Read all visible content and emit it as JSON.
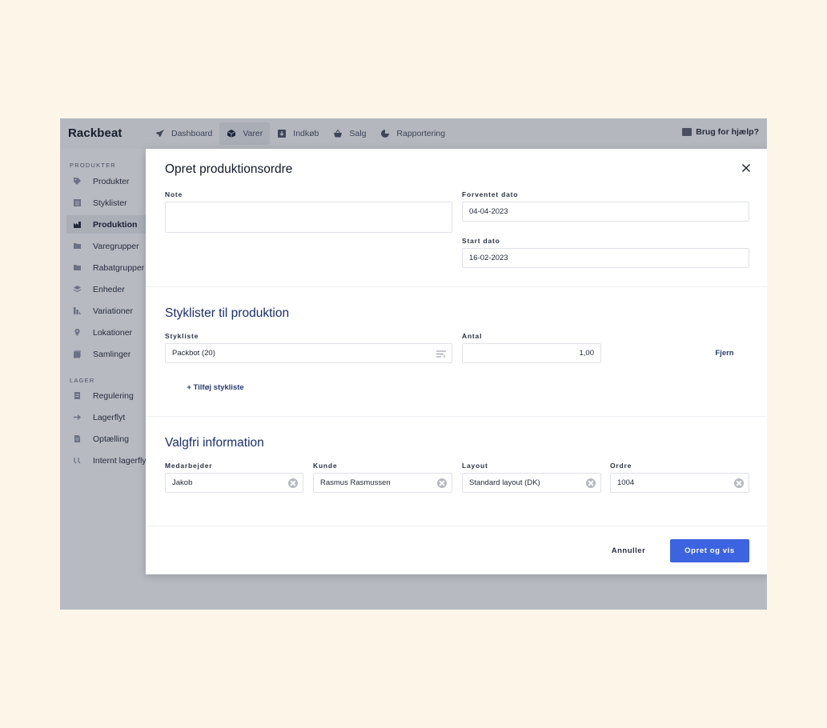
{
  "app": {
    "logo": "Rackbeat",
    "nav": [
      {
        "label": "Dashboard",
        "icon": "rocket-icon"
      },
      {
        "label": "Varer",
        "icon": "box-icon",
        "active": true
      },
      {
        "label": "Indkøb",
        "icon": "download-icon"
      },
      {
        "label": "Salg",
        "icon": "basket-icon"
      },
      {
        "label": "Rapportering",
        "icon": "pie-chart-icon"
      }
    ],
    "help": "Brug for hjælp?"
  },
  "sidebar": {
    "section_products": "PRODUKTER",
    "products": [
      {
        "label": "Produkter",
        "icon": "tag-icon"
      },
      {
        "label": "Styklister",
        "icon": "list-icon"
      },
      {
        "label": "Produktion",
        "icon": "factory-icon",
        "active": true
      },
      {
        "label": "Varegrupper",
        "icon": "folder-icon"
      },
      {
        "label": "Rabatgrupper",
        "icon": "folder-icon"
      },
      {
        "label": "Enheder",
        "icon": "layers-icon"
      },
      {
        "label": "Variationer",
        "icon": "variations-icon"
      },
      {
        "label": "Lokationer",
        "icon": "location-pin-icon"
      },
      {
        "label": "Samlinger",
        "icon": "collection-icon"
      }
    ],
    "section_stock": "LAGER",
    "stock": [
      {
        "label": "Regulering",
        "icon": "adjust-icon"
      },
      {
        "label": "Lagerflyt",
        "icon": "arrow-right-icon"
      },
      {
        "label": "Optælling",
        "icon": "document-icon"
      },
      {
        "label": "Internt lagerflyt",
        "icon": "internal-move-icon"
      }
    ]
  },
  "modal": {
    "title": "Opret produktionsordre",
    "note_label": "Note",
    "note_value": "",
    "expected_date_label": "Forventet dato",
    "expected_date_value": "04-04-2023",
    "start_date_label": "Start dato",
    "start_date_value": "16-02-2023",
    "bom_section_title": "Styklister til produktion",
    "bom_label": "Stykliste",
    "bom_value": "Packbot (20)",
    "qty_label": "Antal",
    "qty_value": "1,00",
    "remove_label": "Fjern",
    "add_bom_label": "+ Tilføj stykliste",
    "optional_section_title": "Valgfri information",
    "employee_label": "Medarbejder",
    "employee_value": "Jakob",
    "customer_label": "Kunde",
    "customer_value": "Rasmus Rasmussen",
    "layout_label": "Layout",
    "layout_value": "Standard layout (DK)",
    "order_label": "Ordre",
    "order_value": "1004",
    "cancel_label": "Annuller",
    "submit_label": "Opret og vis"
  },
  "colors": {
    "page_bg": "#fdf6e8",
    "app_bg": "#b7bac1",
    "accent": "#3c63e0",
    "section_title": "#1a2e6d"
  }
}
